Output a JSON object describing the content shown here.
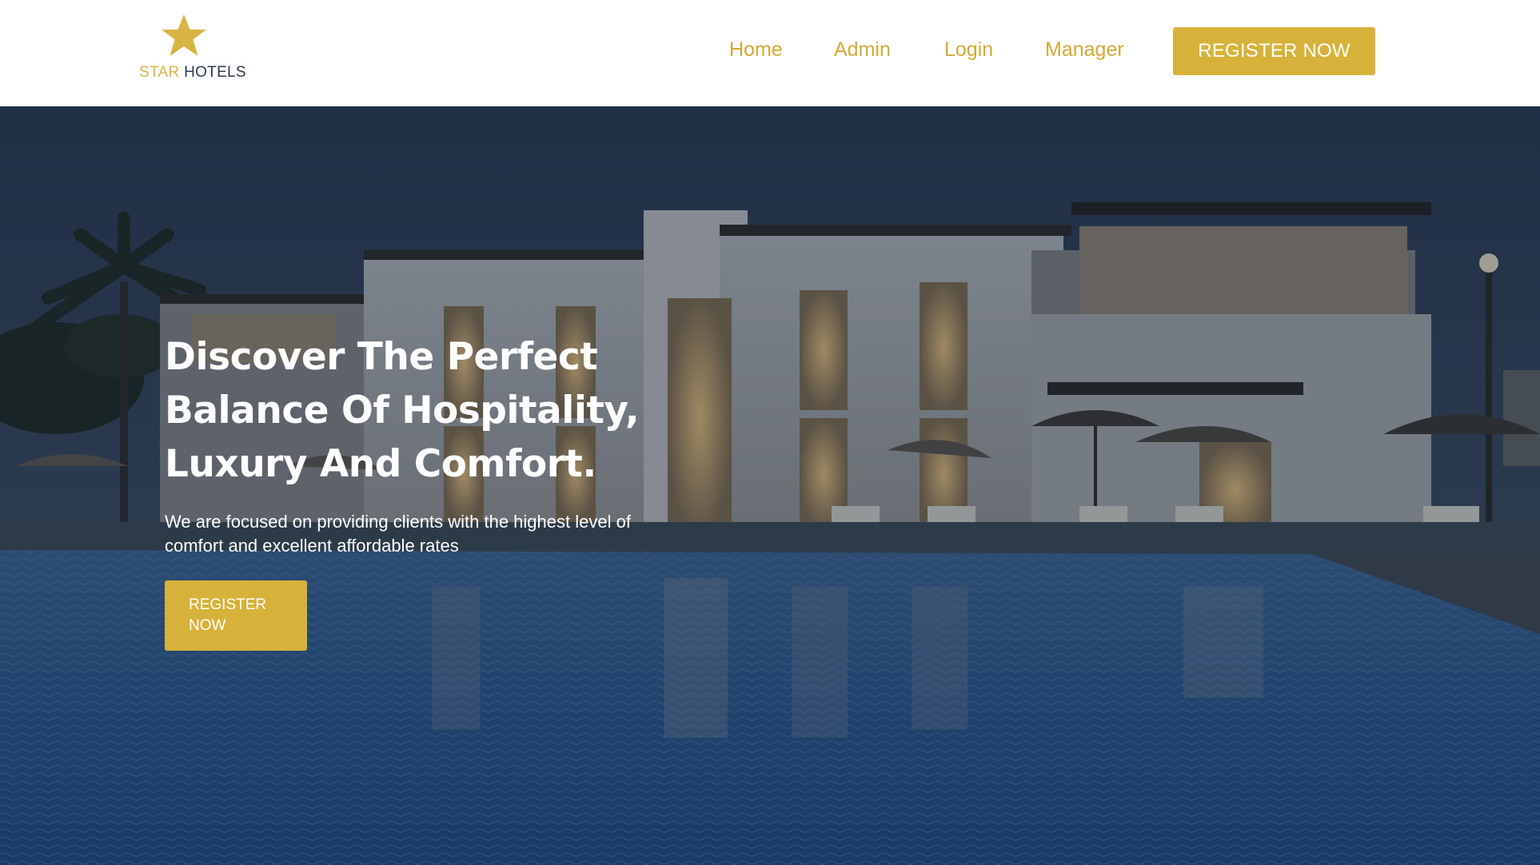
{
  "brand": {
    "star_word": "STAR",
    "hotels_word": "HOTELS",
    "logo_icon": "star-icon",
    "accent_color": "#d7b23a",
    "text_color": "#2f3b4c"
  },
  "nav": {
    "home": "Home",
    "admin": "Admin",
    "login": "Login",
    "manager": "Manager",
    "register": "REGISTER NOW"
  },
  "hero": {
    "title": "Discover The Perfect Balance Of Hospitality, Luxury And Comfort.",
    "subtitle": "We are focused on providing clients with the highest level of comfort and excellent affordable rates",
    "cta": "REGISTER NOW",
    "background": "night-hotel-pool-photo"
  }
}
